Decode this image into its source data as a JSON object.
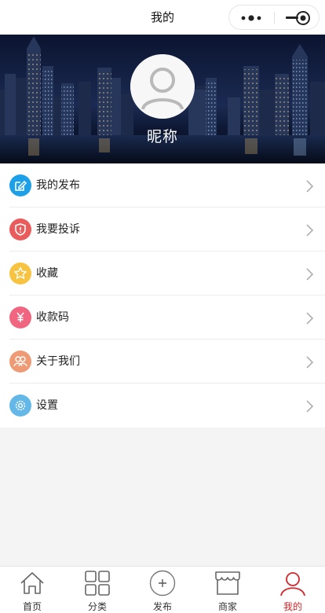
{
  "navbar": {
    "title": "我的"
  },
  "profile": {
    "nickname": "昵称"
  },
  "menu": {
    "items": [
      {
        "label": "我的发布",
        "icon": "edit-icon",
        "color": "#1ea0e8"
      },
      {
        "label": "我要投诉",
        "icon": "shield-icon",
        "color": "#ea5b5b"
      },
      {
        "label": "收藏",
        "icon": "star-icon",
        "color": "#f7c340"
      },
      {
        "label": "收款码",
        "icon": "yen-icon",
        "color": "#f0657f"
      },
      {
        "label": "关于我们",
        "icon": "group-icon",
        "color": "#ee9a75"
      },
      {
        "label": "设置",
        "icon": "gear-icon",
        "color": "#63b8e8"
      }
    ]
  },
  "tabbar": {
    "tabs": [
      {
        "label": "首页",
        "icon": "home-icon"
      },
      {
        "label": "分类",
        "icon": "grid-icon"
      },
      {
        "label": "发布",
        "icon": "plus-circle-icon"
      },
      {
        "label": "商家",
        "icon": "store-icon"
      },
      {
        "label": "我的",
        "icon": "person-icon"
      }
    ],
    "active_index": 4,
    "active_color": "#d2262c"
  }
}
